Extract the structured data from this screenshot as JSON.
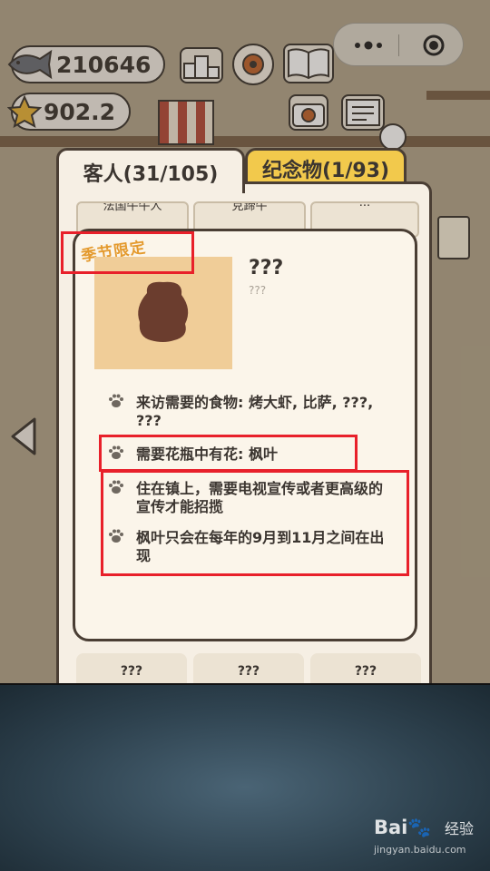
{
  "hud": {
    "fish_count": "210646",
    "star_count": "902.2"
  },
  "tabs": [
    {
      "label": "客人(31/105)",
      "active": true
    },
    {
      "label": "纪念物(1/93)",
      "active": false
    }
  ],
  "top_cards": [
    "法国牛牛人",
    "克蹄牛",
    "..."
  ],
  "dialog": {
    "seasonal_tag": "季节限定",
    "name": "???",
    "subname": "???",
    "info": [
      {
        "text": "来访需要的食物: 烤大虾, 比萨, ???, ???"
      },
      {
        "text": "需要花瓶中有花: 枫叶"
      },
      {
        "text": "住在镇上，需要电视宣传或者更高级的宣传才能招揽"
      },
      {
        "text": "枫叶只会在每年的9月到11月之间在出现"
      }
    ]
  },
  "bottom_cards": [
    "???",
    "???",
    "???"
  ],
  "watermark": {
    "logo": "Bai🐾",
    "text": "经验",
    "url": "jingyan.baidu.com"
  },
  "colors": {
    "accent_tab": "#f2c94c",
    "highlight_box": "#e8202a",
    "seasonal_tag": "#e49a2e"
  }
}
